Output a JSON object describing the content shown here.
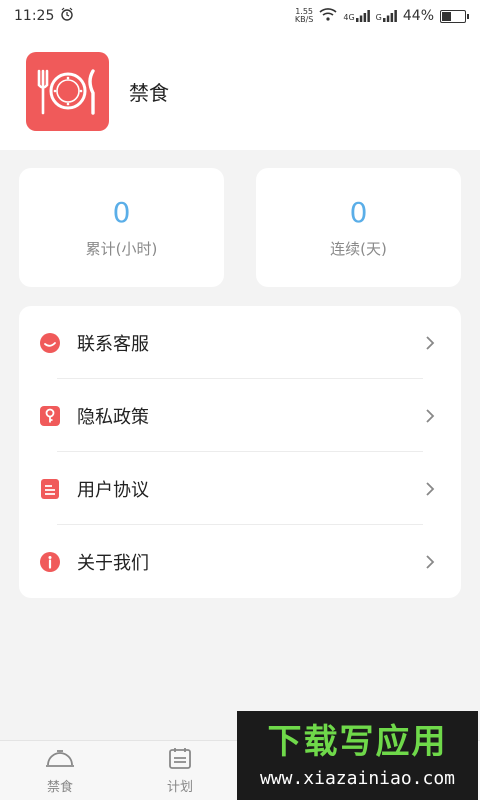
{
  "status_bar": {
    "time": "11:25",
    "speed_value": "1.55",
    "speed_unit": "KB/S",
    "net_4g": "4G",
    "net_g": "G",
    "battery": "44%",
    "battery_level": 0.44
  },
  "header": {
    "app_name": "禁食",
    "logo_color": "#f05a5a"
  },
  "stats": [
    {
      "value": "0",
      "label": "累计(小时)"
    },
    {
      "value": "0",
      "label": "连续(天)"
    }
  ],
  "menu": [
    {
      "label": "联系客服",
      "icon": "customer-service-icon"
    },
    {
      "label": "隐私政策",
      "icon": "privacy-icon"
    },
    {
      "label": "用户协议",
      "icon": "agreement-icon"
    },
    {
      "label": "关于我们",
      "icon": "info-icon"
    }
  ],
  "tabbar": [
    {
      "label": "禁食",
      "icon": "fasting-icon"
    },
    {
      "label": "计划",
      "icon": "calendar-icon"
    }
  ],
  "watermark": {
    "title": "下载写应用",
    "url": "www.xiazainiao.com"
  },
  "colors": {
    "accent": "#f05a5a",
    "stat_value": "#5aaee8",
    "background": "#f3f3f3"
  }
}
